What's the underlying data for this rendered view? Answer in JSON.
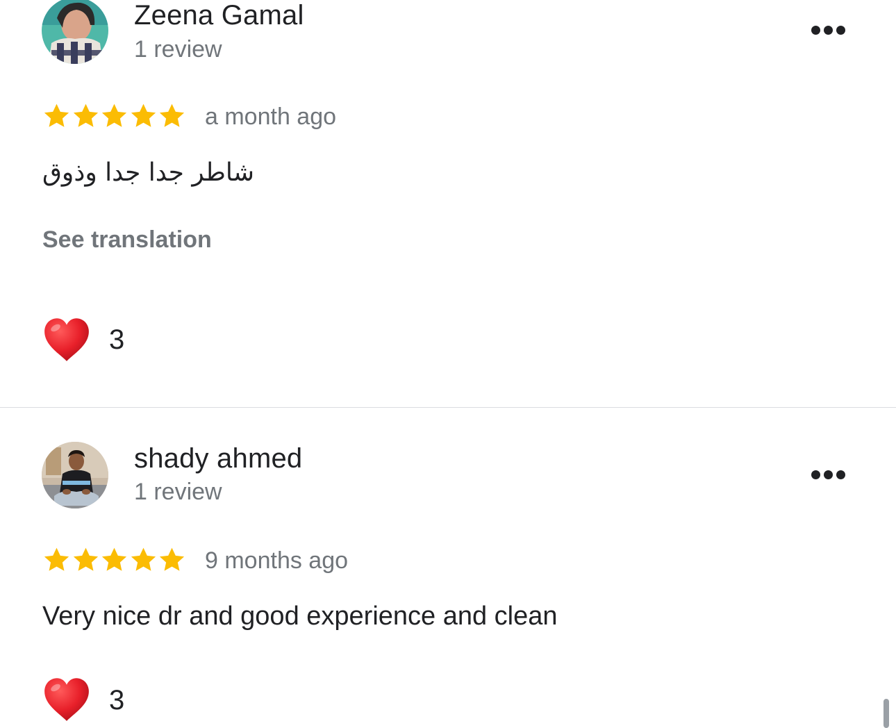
{
  "reviews": [
    {
      "reviewer": "Zeena Gamal",
      "review_count": "1 review",
      "rating": 5,
      "date": "a month ago",
      "text": "شاطر جدا جدا وذوق",
      "translate_label": "See translation",
      "likes": "3",
      "avatar_icon": "avatar-photo"
    },
    {
      "reviewer": "shady ahmed",
      "review_count": "1 review",
      "rating": 5,
      "date": "9 months ago",
      "text": "Very nice dr and good experience and clean",
      "likes": "3",
      "avatar_icon": "avatar-photo"
    }
  ],
  "icons": {
    "star": "star-icon",
    "heart": "heart-icon",
    "more": "more-options-icon"
  },
  "colors": {
    "star": "#fbbc04",
    "heart": "#e8202a",
    "secondary_text": "#70757a",
    "primary_text": "#202124"
  }
}
